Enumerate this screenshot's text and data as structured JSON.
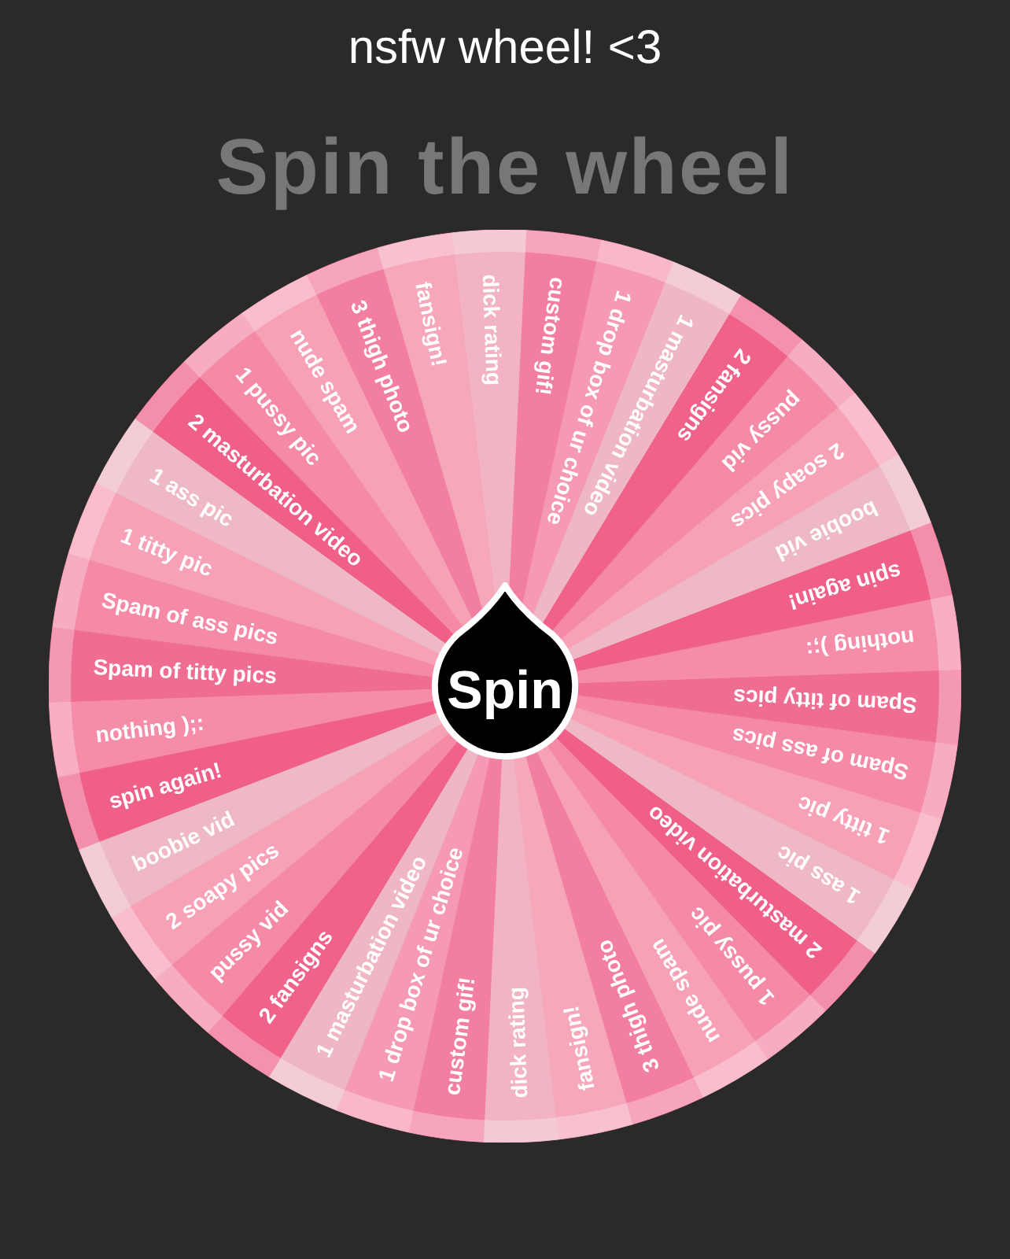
{
  "caption": "nsfw wheel! <3",
  "heading": "Spin the wheel",
  "wheel": {
    "button": "Spin",
    "segments": [
      {
        "label": "dick rating"
      },
      {
        "label": "custom gif!"
      },
      {
        "label": "1 drop box of ur choice"
      },
      {
        "label": "1 masturbation video"
      },
      {
        "label": "2 fansigns"
      },
      {
        "label": "pussy vid"
      },
      {
        "label": "2 soapy pics"
      },
      {
        "label": "boobie vid"
      },
      {
        "label": "spin again!"
      },
      {
        "label": "nothing );:"
      },
      {
        "label": "Spam of titty pics"
      },
      {
        "label": "Spam of ass pics"
      },
      {
        "label": "1 titty pic"
      },
      {
        "label": "1 ass pic"
      },
      {
        "label": "2 masturbation video"
      },
      {
        "label": "1 pussy pic"
      },
      {
        "label": "nude spam"
      },
      {
        "label": "3 thigh photo"
      },
      {
        "label": "fansign!"
      },
      {
        "label": "dick rating"
      },
      {
        "label": "custom gif!"
      },
      {
        "label": "1 drop box of ur choice"
      },
      {
        "label": "1 masturbation video"
      },
      {
        "label": "2 fansigns"
      },
      {
        "label": "pussy vid"
      },
      {
        "label": "2 soapy pics"
      },
      {
        "label": "boobie vid"
      },
      {
        "label": "spin again!"
      },
      {
        "label": "nothing );:"
      },
      {
        "label": "Spam of titty pics"
      },
      {
        "label": "Spam of ass pics"
      },
      {
        "label": "1 titty pic"
      },
      {
        "label": "1 ass pic"
      },
      {
        "label": "2 masturbation video"
      },
      {
        "label": "1 pussy pic"
      },
      {
        "label": "nude spam"
      },
      {
        "label": "3 thigh photo"
      },
      {
        "label": "fansign!"
      }
    ]
  }
}
